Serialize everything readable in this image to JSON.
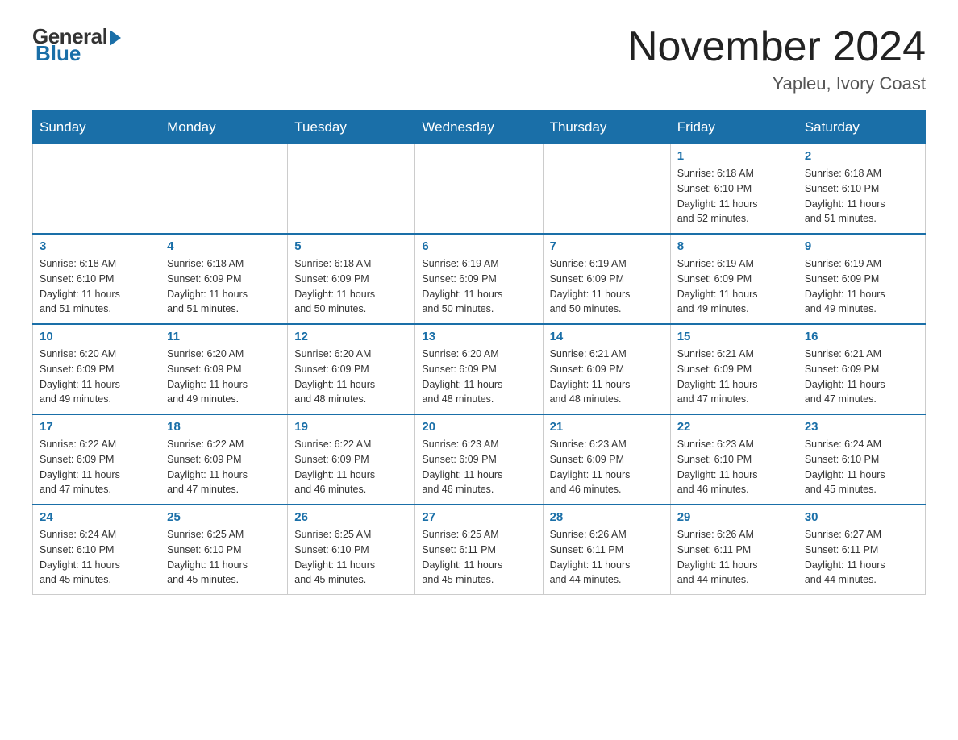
{
  "header": {
    "logo": {
      "general_text": "General",
      "blue_text": "Blue"
    },
    "title": "November 2024",
    "subtitle": "Yapleu, Ivory Coast"
  },
  "weekdays": [
    "Sunday",
    "Monday",
    "Tuesday",
    "Wednesday",
    "Thursday",
    "Friday",
    "Saturday"
  ],
  "weeks": [
    [
      {
        "day": "",
        "info": ""
      },
      {
        "day": "",
        "info": ""
      },
      {
        "day": "",
        "info": ""
      },
      {
        "day": "",
        "info": ""
      },
      {
        "day": "",
        "info": ""
      },
      {
        "day": "1",
        "info": "Sunrise: 6:18 AM\nSunset: 6:10 PM\nDaylight: 11 hours\nand 52 minutes."
      },
      {
        "day": "2",
        "info": "Sunrise: 6:18 AM\nSunset: 6:10 PM\nDaylight: 11 hours\nand 51 minutes."
      }
    ],
    [
      {
        "day": "3",
        "info": "Sunrise: 6:18 AM\nSunset: 6:10 PM\nDaylight: 11 hours\nand 51 minutes."
      },
      {
        "day": "4",
        "info": "Sunrise: 6:18 AM\nSunset: 6:09 PM\nDaylight: 11 hours\nand 51 minutes."
      },
      {
        "day": "5",
        "info": "Sunrise: 6:18 AM\nSunset: 6:09 PM\nDaylight: 11 hours\nand 50 minutes."
      },
      {
        "day": "6",
        "info": "Sunrise: 6:19 AM\nSunset: 6:09 PM\nDaylight: 11 hours\nand 50 minutes."
      },
      {
        "day": "7",
        "info": "Sunrise: 6:19 AM\nSunset: 6:09 PM\nDaylight: 11 hours\nand 50 minutes."
      },
      {
        "day": "8",
        "info": "Sunrise: 6:19 AM\nSunset: 6:09 PM\nDaylight: 11 hours\nand 49 minutes."
      },
      {
        "day": "9",
        "info": "Sunrise: 6:19 AM\nSunset: 6:09 PM\nDaylight: 11 hours\nand 49 minutes."
      }
    ],
    [
      {
        "day": "10",
        "info": "Sunrise: 6:20 AM\nSunset: 6:09 PM\nDaylight: 11 hours\nand 49 minutes."
      },
      {
        "day": "11",
        "info": "Sunrise: 6:20 AM\nSunset: 6:09 PM\nDaylight: 11 hours\nand 49 minutes."
      },
      {
        "day": "12",
        "info": "Sunrise: 6:20 AM\nSunset: 6:09 PM\nDaylight: 11 hours\nand 48 minutes."
      },
      {
        "day": "13",
        "info": "Sunrise: 6:20 AM\nSunset: 6:09 PM\nDaylight: 11 hours\nand 48 minutes."
      },
      {
        "day": "14",
        "info": "Sunrise: 6:21 AM\nSunset: 6:09 PM\nDaylight: 11 hours\nand 48 minutes."
      },
      {
        "day": "15",
        "info": "Sunrise: 6:21 AM\nSunset: 6:09 PM\nDaylight: 11 hours\nand 47 minutes."
      },
      {
        "day": "16",
        "info": "Sunrise: 6:21 AM\nSunset: 6:09 PM\nDaylight: 11 hours\nand 47 minutes."
      }
    ],
    [
      {
        "day": "17",
        "info": "Sunrise: 6:22 AM\nSunset: 6:09 PM\nDaylight: 11 hours\nand 47 minutes."
      },
      {
        "day": "18",
        "info": "Sunrise: 6:22 AM\nSunset: 6:09 PM\nDaylight: 11 hours\nand 47 minutes."
      },
      {
        "day": "19",
        "info": "Sunrise: 6:22 AM\nSunset: 6:09 PM\nDaylight: 11 hours\nand 46 minutes."
      },
      {
        "day": "20",
        "info": "Sunrise: 6:23 AM\nSunset: 6:09 PM\nDaylight: 11 hours\nand 46 minutes."
      },
      {
        "day": "21",
        "info": "Sunrise: 6:23 AM\nSunset: 6:09 PM\nDaylight: 11 hours\nand 46 minutes."
      },
      {
        "day": "22",
        "info": "Sunrise: 6:23 AM\nSunset: 6:10 PM\nDaylight: 11 hours\nand 46 minutes."
      },
      {
        "day": "23",
        "info": "Sunrise: 6:24 AM\nSunset: 6:10 PM\nDaylight: 11 hours\nand 45 minutes."
      }
    ],
    [
      {
        "day": "24",
        "info": "Sunrise: 6:24 AM\nSunset: 6:10 PM\nDaylight: 11 hours\nand 45 minutes."
      },
      {
        "day": "25",
        "info": "Sunrise: 6:25 AM\nSunset: 6:10 PM\nDaylight: 11 hours\nand 45 minutes."
      },
      {
        "day": "26",
        "info": "Sunrise: 6:25 AM\nSunset: 6:10 PM\nDaylight: 11 hours\nand 45 minutes."
      },
      {
        "day": "27",
        "info": "Sunrise: 6:25 AM\nSunset: 6:11 PM\nDaylight: 11 hours\nand 45 minutes."
      },
      {
        "day": "28",
        "info": "Sunrise: 6:26 AM\nSunset: 6:11 PM\nDaylight: 11 hours\nand 44 minutes."
      },
      {
        "day": "29",
        "info": "Sunrise: 6:26 AM\nSunset: 6:11 PM\nDaylight: 11 hours\nand 44 minutes."
      },
      {
        "day": "30",
        "info": "Sunrise: 6:27 AM\nSunset: 6:11 PM\nDaylight: 11 hours\nand 44 minutes."
      }
    ]
  ]
}
